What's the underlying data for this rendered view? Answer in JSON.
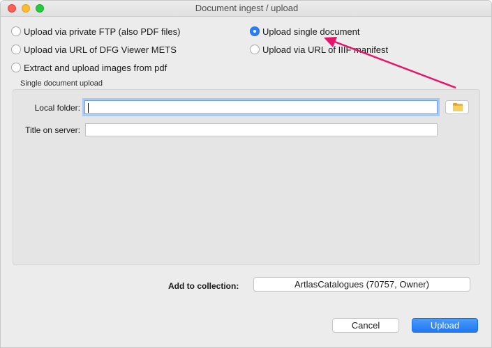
{
  "window": {
    "title": "Document ingest / upload"
  },
  "upload_options": [
    {
      "label": "Upload via private FTP (also PDF files)",
      "checked": false
    },
    {
      "label": "Upload single document",
      "checked": true
    },
    {
      "label": "Upload via URL of DFG Viewer METS",
      "checked": false
    },
    {
      "label": "Upload via URL of IIIF manifest",
      "checked": false
    },
    {
      "label": "Extract and upload images from pdf",
      "checked": false
    }
  ],
  "single_upload": {
    "group_title": "Single document upload",
    "local_folder_label": "Local folder:",
    "local_folder_value": "",
    "title_label": "Title on server:",
    "title_value": "",
    "folder_icon": "folder-icon"
  },
  "collection": {
    "label": "Add to collection:",
    "value": "ArtlasCatalogues (70757, Owner)"
  },
  "buttons": {
    "cancel": "Cancel",
    "upload": "Upload"
  },
  "colors": {
    "accent": "#2a7ff8",
    "annotation_arrow": "#e5156b"
  }
}
